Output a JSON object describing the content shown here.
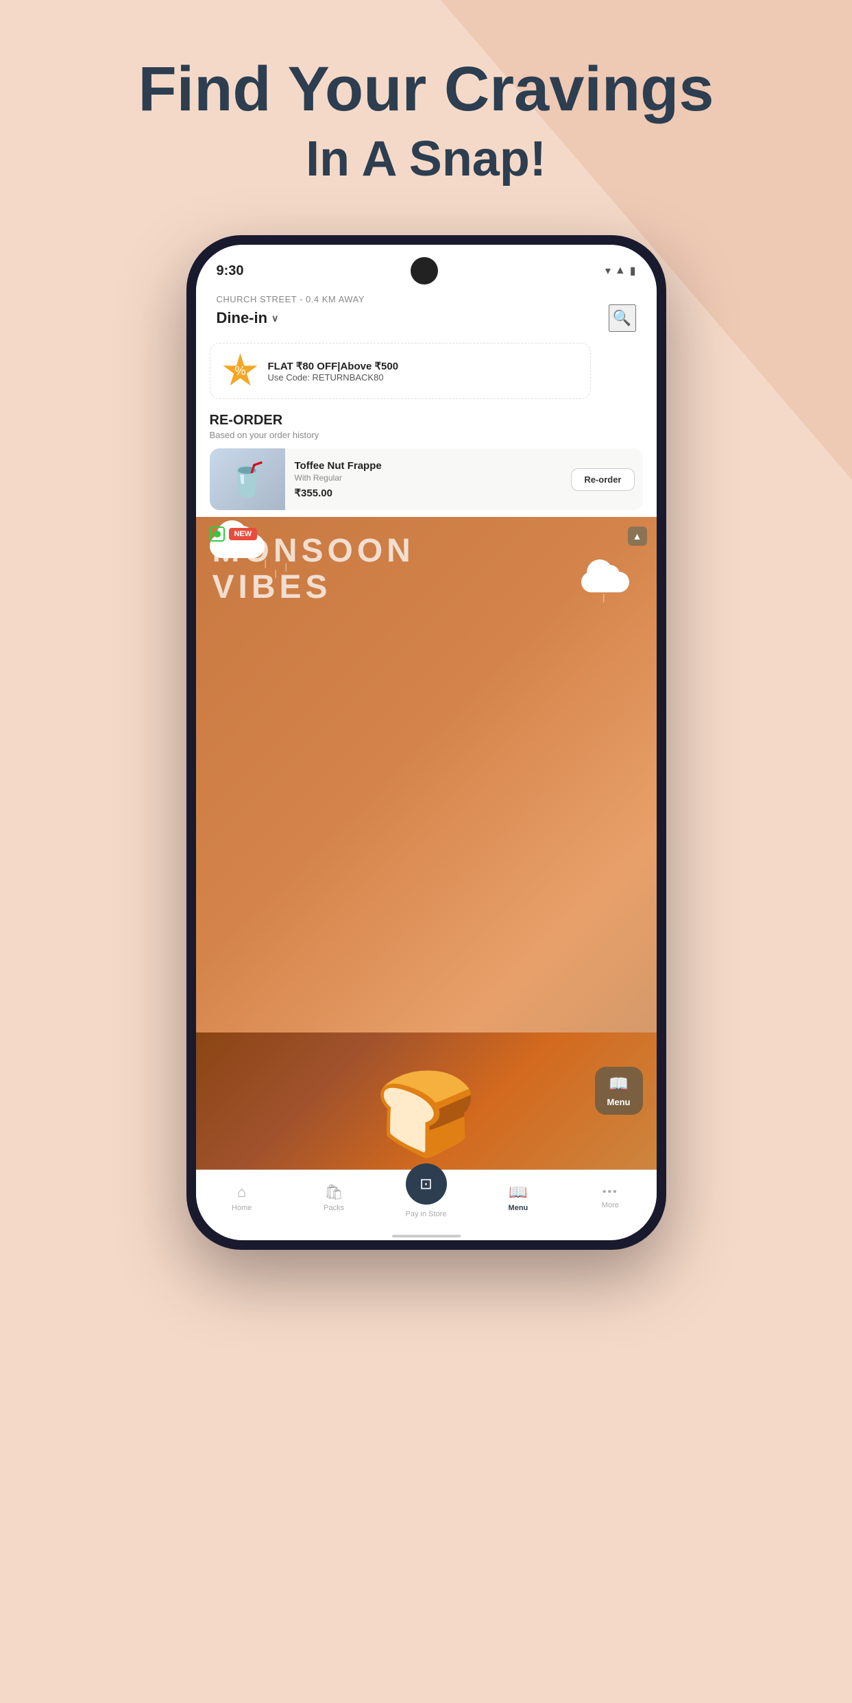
{
  "page": {
    "background_color": "#f5d9c8",
    "headline": "Find Your Cravings",
    "subheadline": "In A Snap!"
  },
  "status_bar": {
    "time": "9:30",
    "wifi": "▾",
    "signal": "▲",
    "battery": "▮"
  },
  "location": {
    "address": "CHURCH STREET - 0.4 KM AWAY",
    "mode": "Dine-in",
    "chevron": "∨"
  },
  "promo": {
    "main_text": "FLAT ₹80 OFF|Above ₹500",
    "sub_text": "Use Code: RETURNBACK80",
    "badge_icon": "%"
  },
  "reorder": {
    "title": "RE-ORDER",
    "subtitle": "Based on your order history",
    "item_name": "Toffee Nut Frappe",
    "item_variant": "With Regular",
    "item_price": "₹355.00",
    "reorder_btn": "Re-order"
  },
  "monsoon": {
    "title_line1": "MONSOON",
    "title_line2": "VIBES",
    "new_label": "NEW"
  },
  "menu_fab": {
    "icon": "📖",
    "label": "Menu"
  },
  "nav": {
    "home_label": "Home",
    "packs_label": "Packs",
    "pay_label": "Pay in Store",
    "menu_label": "Menu",
    "more_label": "More",
    "home_icon": "⌂",
    "packs_icon": "🛍",
    "pay_icon": "⊡",
    "menu_icon": "📖",
    "more_icon": "···"
  }
}
